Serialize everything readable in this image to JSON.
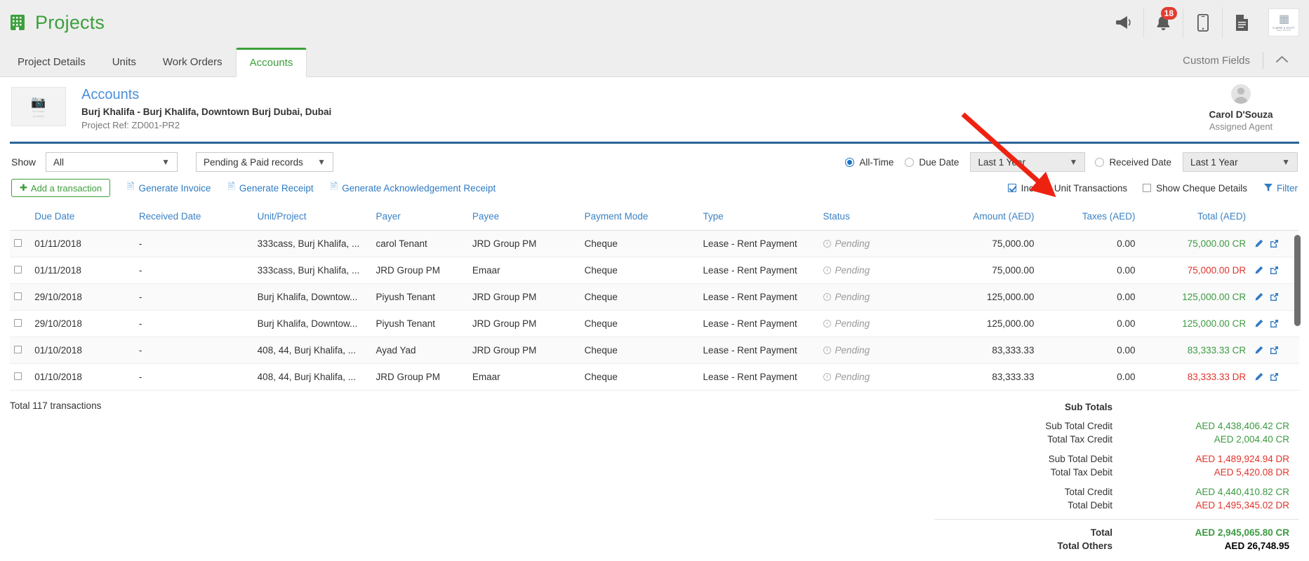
{
  "appbar": {
    "brand_title": "Projects",
    "brand_icon": "building-icon",
    "icons": [
      {
        "name": "megaphone-icon"
      },
      {
        "name": "bell-icon",
        "badge": "18"
      },
      {
        "name": "mobile-icon"
      },
      {
        "name": "document-icon"
      }
    ],
    "company_logo": {
      "mark": "Ἶ2",
      "line1": "CLARKE & SCOTT",
      "line2": "REAL ESTATE"
    }
  },
  "tabs": [
    {
      "label": "Project Details",
      "active": false
    },
    {
      "label": "Units",
      "active": false
    },
    {
      "label": "Work Orders",
      "active": false
    },
    {
      "label": "Accounts",
      "active": true
    }
  ],
  "tabbar_right": {
    "custom_fields_label": "Custom Fields",
    "collapse_icon": "chevron-up-icon"
  },
  "project": {
    "thumb_placeholder_line1": "No Image",
    "thumb_placeholder_line2": "Available",
    "title": "Accounts",
    "subtitle": "Burj Khalifa - Burj Khalifa, Downtown Burj Dubai, Dubai",
    "ref": "Project Ref: ZD001-PR2"
  },
  "agent": {
    "name": "Carol D'Souza",
    "role": "Assigned Agent",
    "avatar_icon": "user-avatar-icon"
  },
  "filters": {
    "show_label": "Show",
    "show_value": "All",
    "records_value": "Pending & Paid records",
    "all_time_label": "All-Time",
    "all_time_selected": true,
    "due_date_label": "Due Date",
    "due_date_selected": false,
    "due_date_range": "Last 1 Year",
    "received_date_label": "Received Date",
    "received_date_selected": false,
    "received_date_range": "Last 1 Year"
  },
  "actions": {
    "add_transaction_label": "Add a transaction",
    "generate_invoice_label": "Generate Invoice",
    "generate_receipt_label": "Generate Receipt",
    "generate_ack_receipt_label": "Generate Acknowledgement Receipt",
    "include_unit_transactions_label": "Include Unit Transactions",
    "include_unit_transactions_checked": true,
    "show_cheque_details_label": "Show Cheque Details",
    "show_cheque_details_checked": false,
    "filter_label": "Filter",
    "filter_icon": "funnel-icon"
  },
  "table": {
    "headers": {
      "due_date": "Due Date",
      "received_date": "Received Date",
      "unit_project": "Unit/Project",
      "payer": "Payer",
      "payee": "Payee",
      "payment_mode": "Payment Mode",
      "type": "Type",
      "status": "Status",
      "amount": "Amount (AED)",
      "taxes": "Taxes (AED)",
      "total": "Total (AED)"
    },
    "rows": [
      {
        "due_date": "01/11/2018",
        "received_date": "-",
        "unit_project": "333cass, Burj Khalifa, ...",
        "payer": "carol Tenant",
        "payee": "JRD Group PM",
        "payment_mode": "Cheque",
        "type": "Lease - Rent Payment",
        "status": "Pending",
        "amount": "75,000.00",
        "taxes": "0.00",
        "total": "75,000.00 CR",
        "total_kind": "cr"
      },
      {
        "due_date": "01/11/2018",
        "received_date": "-",
        "unit_project": "333cass, Burj Khalifa, ...",
        "payer": "JRD Group PM",
        "payee": "Emaar",
        "payment_mode": "Cheque",
        "type": "Lease - Rent Payment",
        "status": "Pending",
        "amount": "75,000.00",
        "taxes": "0.00",
        "total": "75,000.00 DR",
        "total_kind": "dr"
      },
      {
        "due_date": "29/10/2018",
        "received_date": "-",
        "unit_project": "Burj Khalifa, Downtow...",
        "payer": "Piyush Tenant",
        "payee": "JRD Group PM",
        "payment_mode": "Cheque",
        "type": "Lease - Rent Payment",
        "status": "Pending",
        "amount": "125,000.00",
        "taxes": "0.00",
        "total": "125,000.00 CR",
        "total_kind": "cr"
      },
      {
        "due_date": "29/10/2018",
        "received_date": "-",
        "unit_project": "Burj Khalifa, Downtow...",
        "payer": "Piyush Tenant",
        "payee": "JRD Group PM",
        "payment_mode": "Cheque",
        "type": "Lease - Rent Payment",
        "status": "Pending",
        "amount": "125,000.00",
        "taxes": "0.00",
        "total": "125,000.00 CR",
        "total_kind": "cr"
      },
      {
        "due_date": "01/10/2018",
        "received_date": "-",
        "unit_project": "408, 44, Burj Khalifa, ...",
        "payer": "Ayad Yad",
        "payee": "JRD Group PM",
        "payment_mode": "Cheque",
        "type": "Lease - Rent Payment",
        "status": "Pending",
        "amount": "83,333.33",
        "taxes": "0.00",
        "total": "83,333.33 CR",
        "total_kind": "cr"
      },
      {
        "due_date": "01/10/2018",
        "received_date": "-",
        "unit_project": "408, 44, Burj Khalifa, ...",
        "payer": "JRD Group PM",
        "payee": "Emaar",
        "payment_mode": "Cheque",
        "type": "Lease - Rent Payment",
        "status": "Pending",
        "amount": "83,333.33",
        "taxes": "0.00",
        "total": "83,333.33 DR",
        "total_kind": "dr"
      }
    ]
  },
  "summary": {
    "transaction_count_text": "Total 117 transactions",
    "sub_totals_label": "Sub Totals",
    "lines": [
      {
        "label": "Sub Total Credit",
        "value": "AED 4,438,406.42 CR",
        "kind": "cr"
      },
      {
        "label": "Total Tax Credit",
        "value": "AED 2,004.40 CR",
        "kind": "cr"
      },
      {
        "label": "Sub Total Debit",
        "value": "AED 1,489,924.94 DR",
        "kind": "dr"
      },
      {
        "label": "Total Tax Debit",
        "value": "AED 5,420.08 DR",
        "kind": "dr"
      },
      {
        "label": "Total Credit",
        "value": "AED 4,440,410.82 CR",
        "kind": "cr"
      },
      {
        "label": "Total Debit",
        "value": "AED 1,495,345.02 DR",
        "kind": "dr"
      }
    ],
    "total_label": "Total",
    "total_value": "AED 2,945,065.80 CR",
    "total_others_label": "Total Others",
    "total_others_value": "AED 26,748.95"
  },
  "annotation": {
    "arrow_color": "#ee2211",
    "points_to": "include-unit-transactions-checkbox"
  },
  "colors": {
    "brand_green": "#3ca03c",
    "link_blue": "#2f7bc4",
    "header_blue": "#3b82c4",
    "credit_green": "#3c9a41",
    "debit_red": "#e0342b",
    "badge_red": "#e23b32",
    "rule_blue": "#2a6496"
  }
}
